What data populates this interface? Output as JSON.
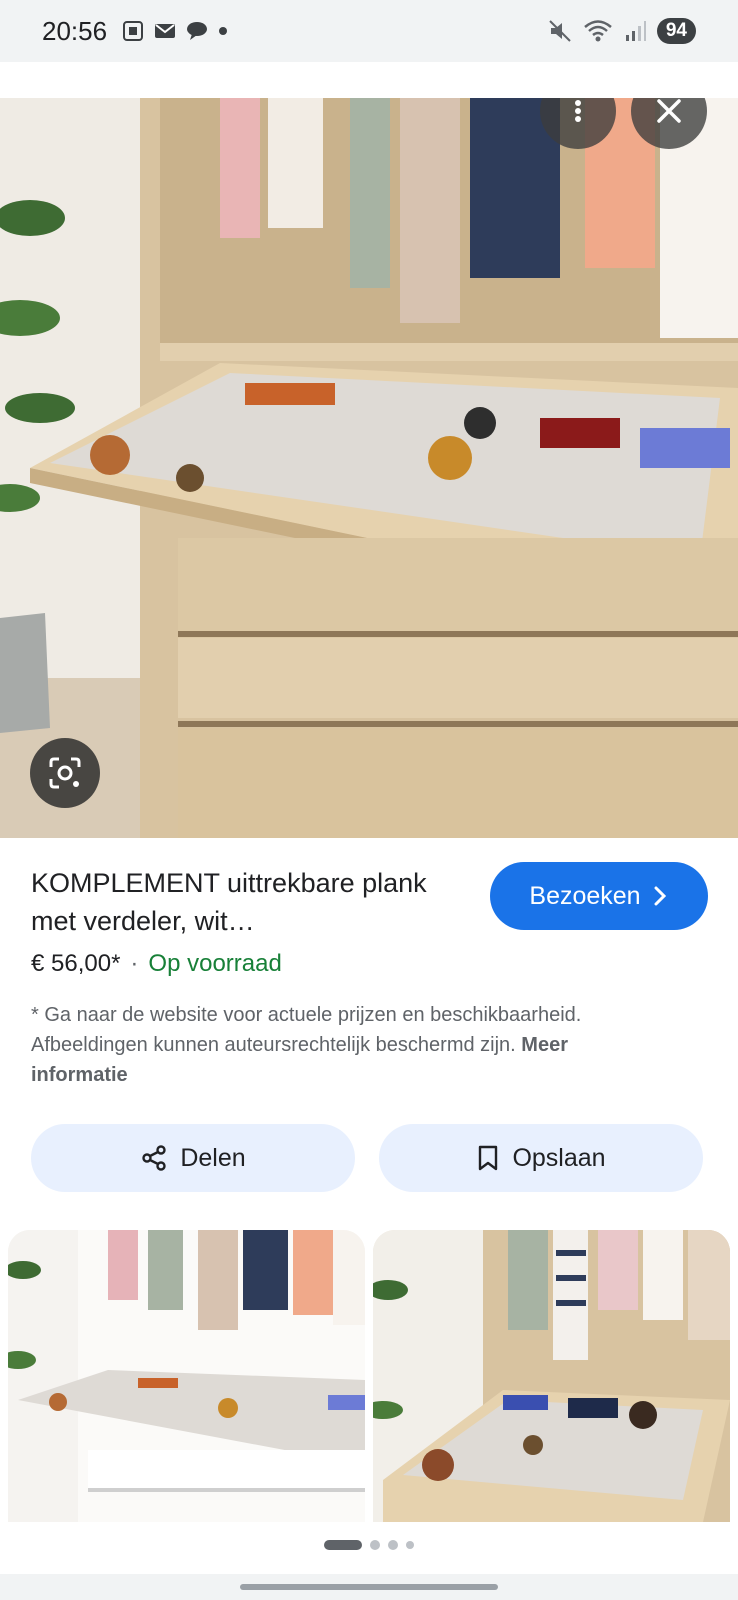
{
  "status_bar": {
    "time": "20:56",
    "battery": "94",
    "icons_left": [
      "screenshot-icon",
      "mail-icon",
      "chat-icon",
      "dot-icon"
    ],
    "icons_right": [
      "mute-icon",
      "wifi-icon",
      "signal-icon"
    ]
  },
  "hero": {
    "menu_icon": "more-vert-icon",
    "close_icon": "close-icon",
    "lens_icon": "lens-icon"
  },
  "product": {
    "title": "KOMPLEMENT uittrekbare plank met verdeler, wit…",
    "visit_label": "Bezoeken",
    "price": "€ 56,00*",
    "separator": "·",
    "stock": "Op voorraad",
    "disclaimer": "* Ga naar de website voor actuele prijzen en beschikbaarheid. Afbeeldingen kunnen auteursrechtelijk beschermd zijn.",
    "more_info": "Meer informatie"
  },
  "actions": {
    "share_label": "Delen",
    "save_label": "Opslaan"
  },
  "pager": {
    "count": 4,
    "active_index": 0
  },
  "colors": {
    "accent": "#1a73e8",
    "action_bg": "#e8f0fe",
    "stock_green": "#188038"
  }
}
